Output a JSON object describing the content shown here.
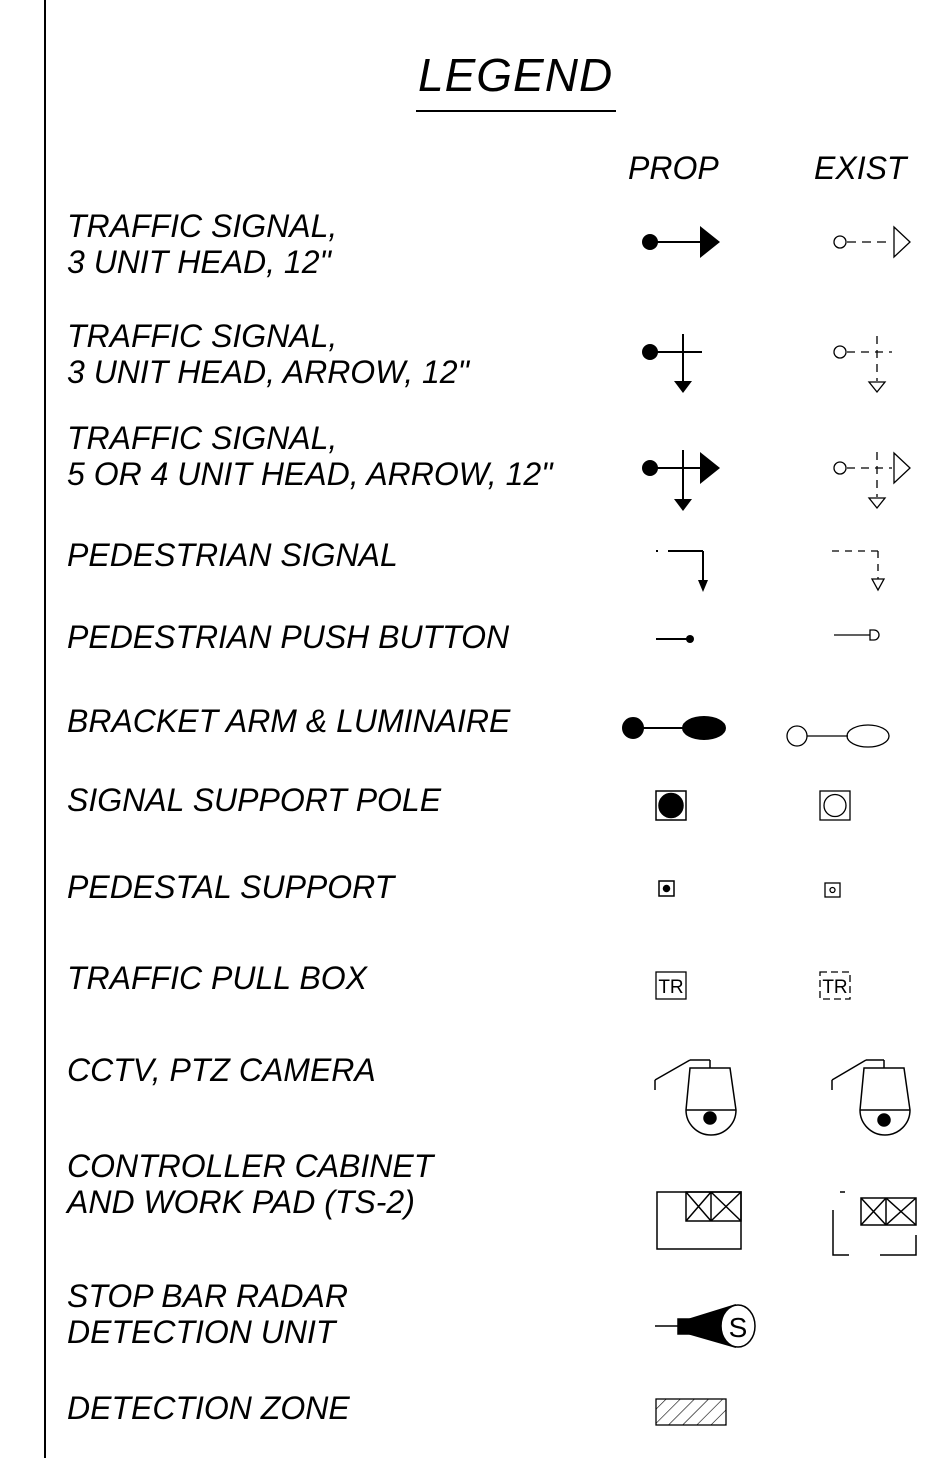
{
  "title": "LEGEND",
  "columns": {
    "prop": "PROP",
    "exist": "EXIST"
  },
  "items": [
    {
      "line1": "TRAFFIC SIGNAL,",
      "line2": "3 UNIT HEAD, 12\"",
      "symbol": "signal-3-unit-head-icon"
    },
    {
      "line1": "TRAFFIC SIGNAL,",
      "line2": "3 UNIT HEAD, ARROW, 12\"",
      "symbol": "signal-3-unit-arrow-icon"
    },
    {
      "line1": "TRAFFIC SIGNAL,",
      "line2": "5 OR 4 UNIT HEAD, ARROW, 12\"",
      "symbol": "signal-5-unit-arrow-icon"
    },
    {
      "line1": "PEDESTRIAN SIGNAL",
      "symbol": "pedestrian-signal-icon"
    },
    {
      "line1": "PEDESTRIAN PUSH BUTTON",
      "symbol": "push-button-icon"
    },
    {
      "line1": "BRACKET ARM & LUMINAIRE",
      "symbol": "luminaire-icon"
    },
    {
      "line1": "SIGNAL SUPPORT POLE",
      "symbol": "support-pole-icon"
    },
    {
      "line1": "PEDESTAL SUPPORT",
      "symbol": "pedestal-icon"
    },
    {
      "line1": "TRAFFIC PULL BOX",
      "symbol": "pull-box-icon",
      "symbol_text": "TR"
    },
    {
      "line1": "CCTV, PTZ CAMERA",
      "symbol": "camera-icon"
    },
    {
      "line1": "CONTROLLER CABINET",
      "line2": "AND WORK PAD (TS-2)",
      "symbol": "cabinet-icon"
    },
    {
      "line1": "STOP BAR RADAR",
      "line2": "DETECTION UNIT",
      "symbol": "radar-icon",
      "symbol_text": "S"
    },
    {
      "line1": "DETECTION ZONE",
      "symbol": "detection-zone-icon"
    }
  ]
}
